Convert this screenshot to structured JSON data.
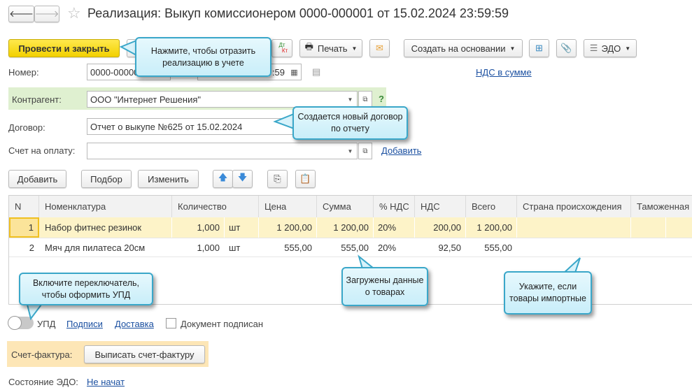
{
  "title": "Реализация: Выкуп комиссионером 0000-000001 от 15.02.2024 23:59:59",
  "toolbar": {
    "post_close": "Провести и закрыть",
    "print": "Печать",
    "create_based": "Создать на основании",
    "edo": "ЭДО",
    "dt": "Дт",
    "kt": "Кт"
  },
  "callouts": {
    "post": "Нажмите, чтобы отразить реализацию в учете",
    "contract": "Создается новый договор по отчету",
    "goods": "Загружены данные о товарах",
    "import": "Укажите, если товары импортные",
    "upd": "Включите переключатель, чтобы оформить УПД"
  },
  "form": {
    "number_label": "Номер:",
    "number_value": "0000-000001",
    "date_value": "15.02.2024 23:59:59",
    "date_visible": ":59",
    "vat_link": "НДС в сумме",
    "counterparty_label": "Контрагент:",
    "counterparty_value": "ООО \"Интернет Решения\"",
    "help": "?",
    "contract_label": "Договор:",
    "contract_value": "Отчет о выкупе №625 от 15.02.2024",
    "invoice_label": "Счет на оплату:",
    "invoice_value": "",
    "add_link": "Добавить"
  },
  "table_toolbar": {
    "add": "Добавить",
    "pick": "Подбор",
    "edit": "Изменить"
  },
  "table": {
    "columns": [
      "N",
      "Номенклатура",
      "Количество",
      "Цена",
      "Сумма",
      "% НДС",
      "НДС",
      "Всего",
      "Страна происхождения",
      "Таможенная"
    ],
    "rows": [
      {
        "n": "1",
        "name": "Набор фитнес резинок",
        "qty": "1,000",
        "unit": "шт",
        "price": "1 200,00",
        "sum": "1 200,00",
        "vat_rate": "20%",
        "vat": "200,00",
        "total": "1 200,00",
        "country": "",
        "customs": ""
      },
      {
        "n": "2",
        "name": "Мяч для пилатеса 20см",
        "qty": "1,000",
        "unit": "шт",
        "price": "555,00",
        "sum": "555,00",
        "vat_rate": "20%",
        "vat": "92,50",
        "total": "555,00",
        "country": "",
        "customs": ""
      }
    ]
  },
  "footer": {
    "upd": "УПД",
    "upd_on": false,
    "signatures": "Подписи",
    "delivery": "Доставка",
    "signed": "Документ подписан",
    "signed_checked": false,
    "invoice_label": "Счет-фактура:",
    "invoice_btn": "Выписать счет-фактуру",
    "edo_label": "Состояние ЭДО:",
    "edo_value": "Не начат"
  },
  "colors": {
    "primary": "#f5d800",
    "counterparty_bg": "#dff0d0",
    "selected_row": "#fdf3c8",
    "invoice_bg": "#fde6b6",
    "callout_border": "#3aa7c9"
  }
}
